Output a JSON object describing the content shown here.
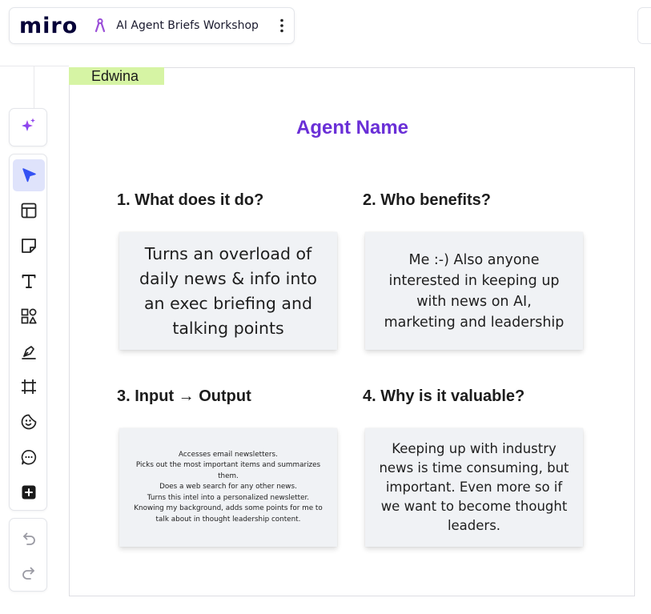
{
  "app": {
    "logo": "miro",
    "board_title": "AI Agent Briefs Workshop",
    "accent_color": "#6a2fd7",
    "tag_color": "#d6f4a4",
    "note_color": "#f0f2f5"
  },
  "toolbar": {
    "ai_tool": "sparkle-icon",
    "tools": [
      {
        "name": "select",
        "icon": "cursor-icon",
        "active": true
      },
      {
        "name": "templates",
        "icon": "layout-icon",
        "active": false
      },
      {
        "name": "sticky-note",
        "icon": "sticky-note-icon",
        "active": false
      },
      {
        "name": "text",
        "icon": "text-icon",
        "active": false
      },
      {
        "name": "shapes",
        "icon": "shapes-icon",
        "active": false
      },
      {
        "name": "pen",
        "icon": "pen-icon",
        "active": false
      },
      {
        "name": "frame",
        "icon": "frame-icon",
        "active": false
      },
      {
        "name": "stickers",
        "icon": "sticker-icon",
        "active": false
      },
      {
        "name": "comment",
        "icon": "comment-icon",
        "active": false
      },
      {
        "name": "more",
        "icon": "plus-icon",
        "active": false
      }
    ],
    "history": [
      "undo-icon",
      "redo-icon"
    ]
  },
  "frame": {
    "author": "Edwina",
    "title": "Agent Name",
    "sections": [
      {
        "heading": "1. What does it do?",
        "note": "Turns an overload of\ndaily news & info into\nan exec briefing and\ntalking points"
      },
      {
        "heading": "2. Who benefits?",
        "note": "Me :-) Also anyone\ninterested in keeping up\nwith news on AI,\nmarketing and leadership"
      },
      {
        "heading": "3. Input → Output",
        "note": "Accesses email newsletters.\nPicks out the most important items and summarizes\nthem.\nDoes a web search for any other news.\nTurns this intel into a personalized newsletter.\nKnowing my background, adds some points for me to\ntalk about in thought leadership content."
      },
      {
        "heading": "4. Why is it valuable?",
        "note": "Keeping up with industry\nnews is time consuming, but\nimportant. Even more so if\nwe want to become thought\nleaders."
      }
    ]
  }
}
